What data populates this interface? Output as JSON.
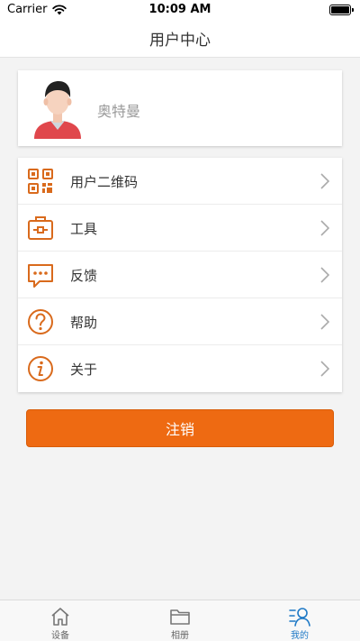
{
  "status_bar": {
    "carrier": "Carrier",
    "time": "10:09 AM",
    "battery_level": 1.0
  },
  "nav": {
    "title": "用户中心"
  },
  "profile": {
    "username": "奥特曼"
  },
  "menu": {
    "items": [
      {
        "label": "用户二维码",
        "icon": "qr-code-icon"
      },
      {
        "label": "工具",
        "icon": "toolbox-icon"
      },
      {
        "label": "反馈",
        "icon": "feedback-icon"
      },
      {
        "label": "帮助",
        "icon": "help-icon"
      },
      {
        "label": "关于",
        "icon": "info-icon"
      }
    ]
  },
  "logout": {
    "label": "注销"
  },
  "tabs": [
    {
      "label": "设备",
      "icon": "home-icon",
      "active": false
    },
    {
      "label": "相册",
      "icon": "folder-icon",
      "active": false
    },
    {
      "label": "我的",
      "icon": "user-icon",
      "active": true
    }
  ],
  "colors": {
    "accent": "#ee6a12",
    "tab_active": "#1e79c6"
  }
}
